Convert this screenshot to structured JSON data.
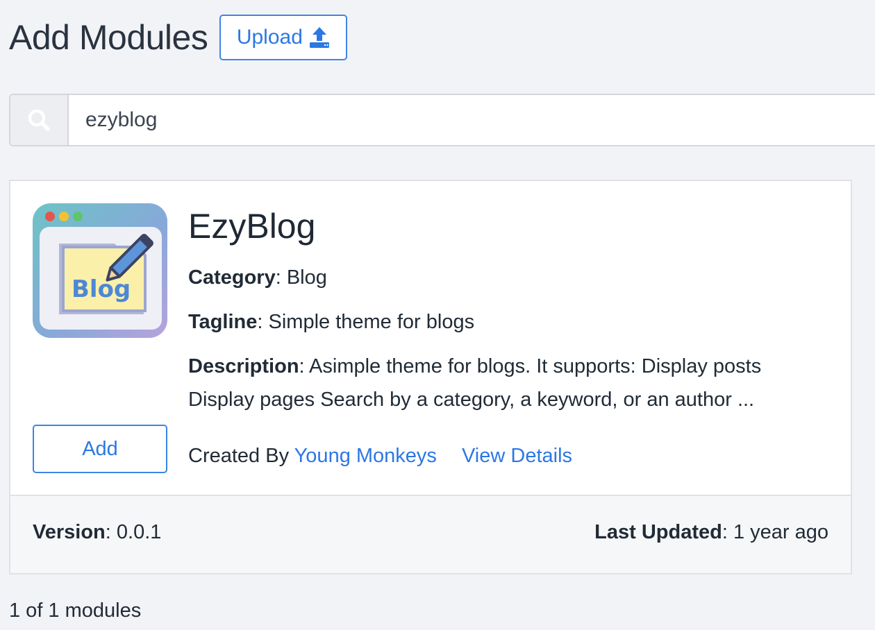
{
  "header": {
    "title": "Add Modules",
    "upload_label": "Upload"
  },
  "search": {
    "value": "ezyblog",
    "icon": "search-icon"
  },
  "module": {
    "name": "EzyBlog",
    "icon_label": "Blog",
    "category_label": "Category",
    "category_value": "Blog",
    "tagline_label": "Tagline",
    "tagline_value": "Simple theme for blogs",
    "description_label": "Description",
    "description_value": "Asimple theme for blogs. It supports: Display posts Display pages Search by a category, a keyword, or an author ...",
    "add_label": "Add",
    "created_by_prefix": "Created By",
    "author": "Young Monkeys",
    "view_details": "View Details",
    "version_label": "Version",
    "version_value": "0.0.1",
    "last_updated_label": "Last Updated",
    "last_updated_value": "1 year ago"
  },
  "footer": {
    "count_text": "1 of 1 modules"
  },
  "colors": {
    "accent": "#2b78e4",
    "background": "#f2f3f7",
    "border": "#dfe1e6"
  }
}
